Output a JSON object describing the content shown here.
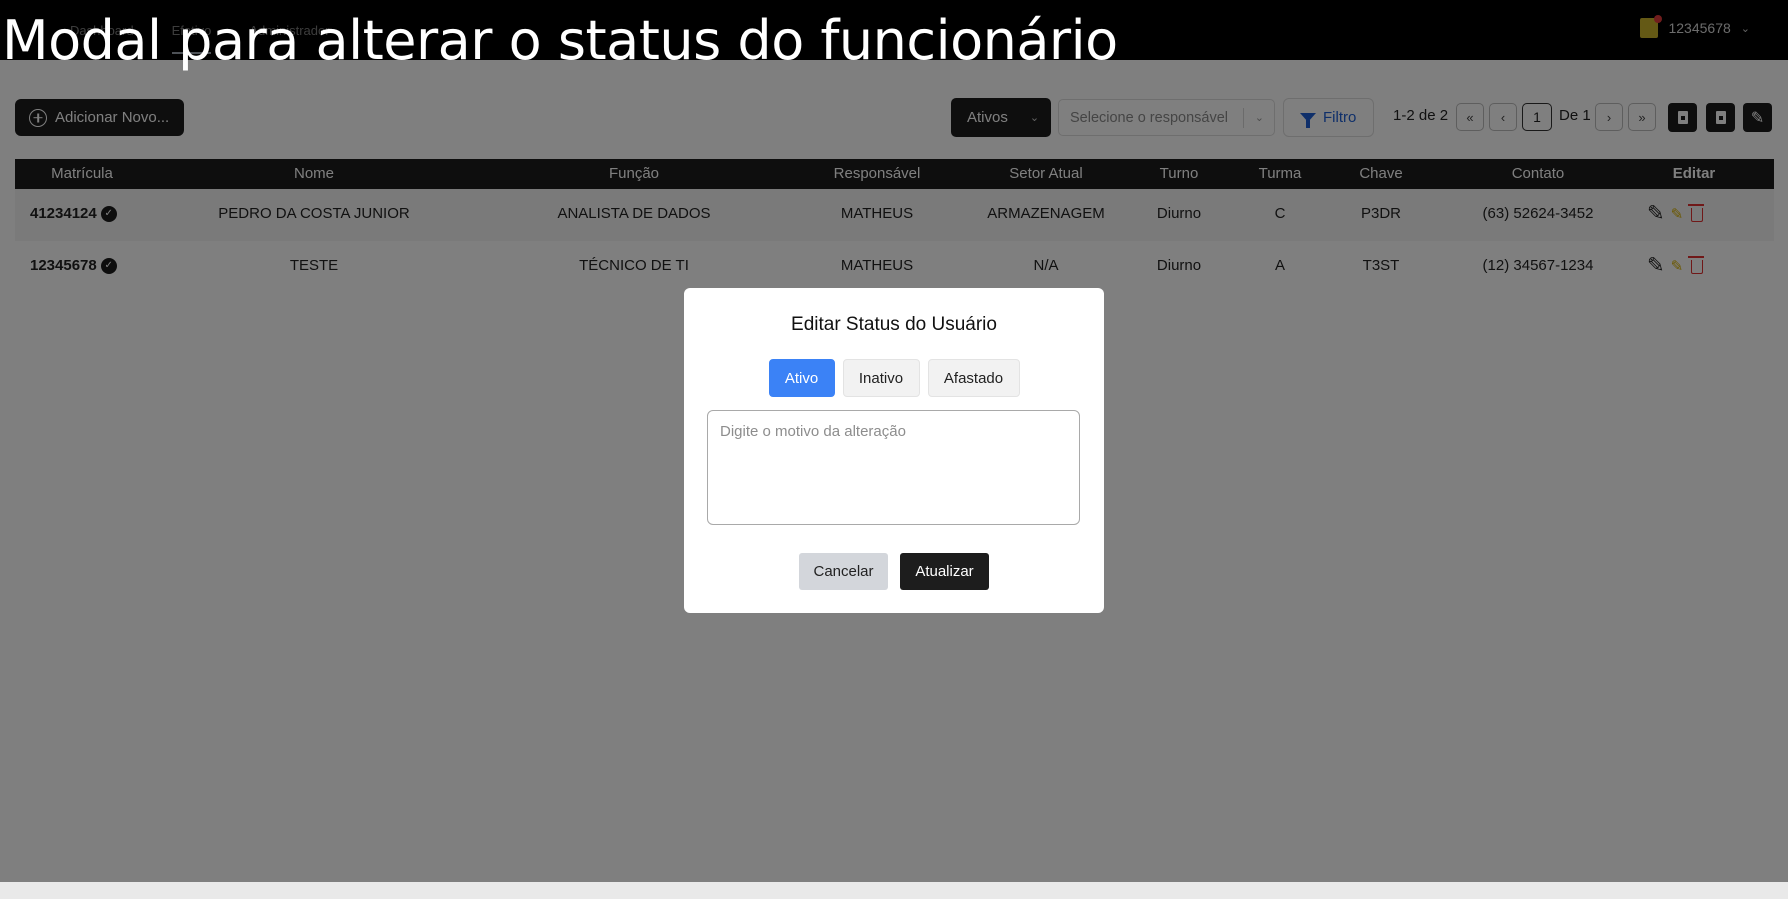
{
  "slide_title": "Modal para alterar o status do funcionário",
  "nav": {
    "links": [
      "Dashboard",
      "Efetivo",
      "Administrador"
    ],
    "user_id": "12345678"
  },
  "toolbar": {
    "add_label": "Adicionar Novo...",
    "status_filter_value": "Ativos",
    "responsavel_placeholder": "Selecione o responsável",
    "filter_label": "Filtro",
    "range_text": "1-2 de 2",
    "page_current": "1",
    "page_total_text": "De 1"
  },
  "table": {
    "headers": [
      "Matrícula",
      "Nome",
      "Função",
      "Responsável",
      "Setor Atual",
      "Turno",
      "Turma",
      "Chave",
      "Contato",
      "Editar"
    ],
    "rows": [
      {
        "matricula": "41234124",
        "nome": "PEDRO DA COSTA JUNIOR",
        "funcao": "ANALISTA DE DADOS",
        "responsavel": "MATHEUS",
        "setor": "ARMAZENAGEM",
        "turno": "Diurno",
        "turma": "C",
        "chave": "P3DR",
        "contato": "(63) 52624-3452"
      },
      {
        "matricula": "12345678",
        "nome": "TESTE",
        "funcao": "TÉCNICO DE TI",
        "responsavel": "MATHEUS",
        "setor": "N/A",
        "turno": "Diurno",
        "turma": "A",
        "chave": "T3ST",
        "contato": "(12) 34567-1234"
      }
    ]
  },
  "modal": {
    "title": "Editar Status do Usuário",
    "status_options": [
      "Ativo",
      "Inativo",
      "Afastado"
    ],
    "selected_status": "Ativo",
    "reason_placeholder": "Digite o motivo da alteração",
    "reason_value": "",
    "cancel_label": "Cancelar",
    "update_label": "Atualizar"
  },
  "colors": {
    "accent_selected": "#3b82f6",
    "dark": "#1d1d1d",
    "filter_blue": "#1e5fd4",
    "delete_red": "#e03030",
    "edit_yellow": "#d7b000"
  }
}
